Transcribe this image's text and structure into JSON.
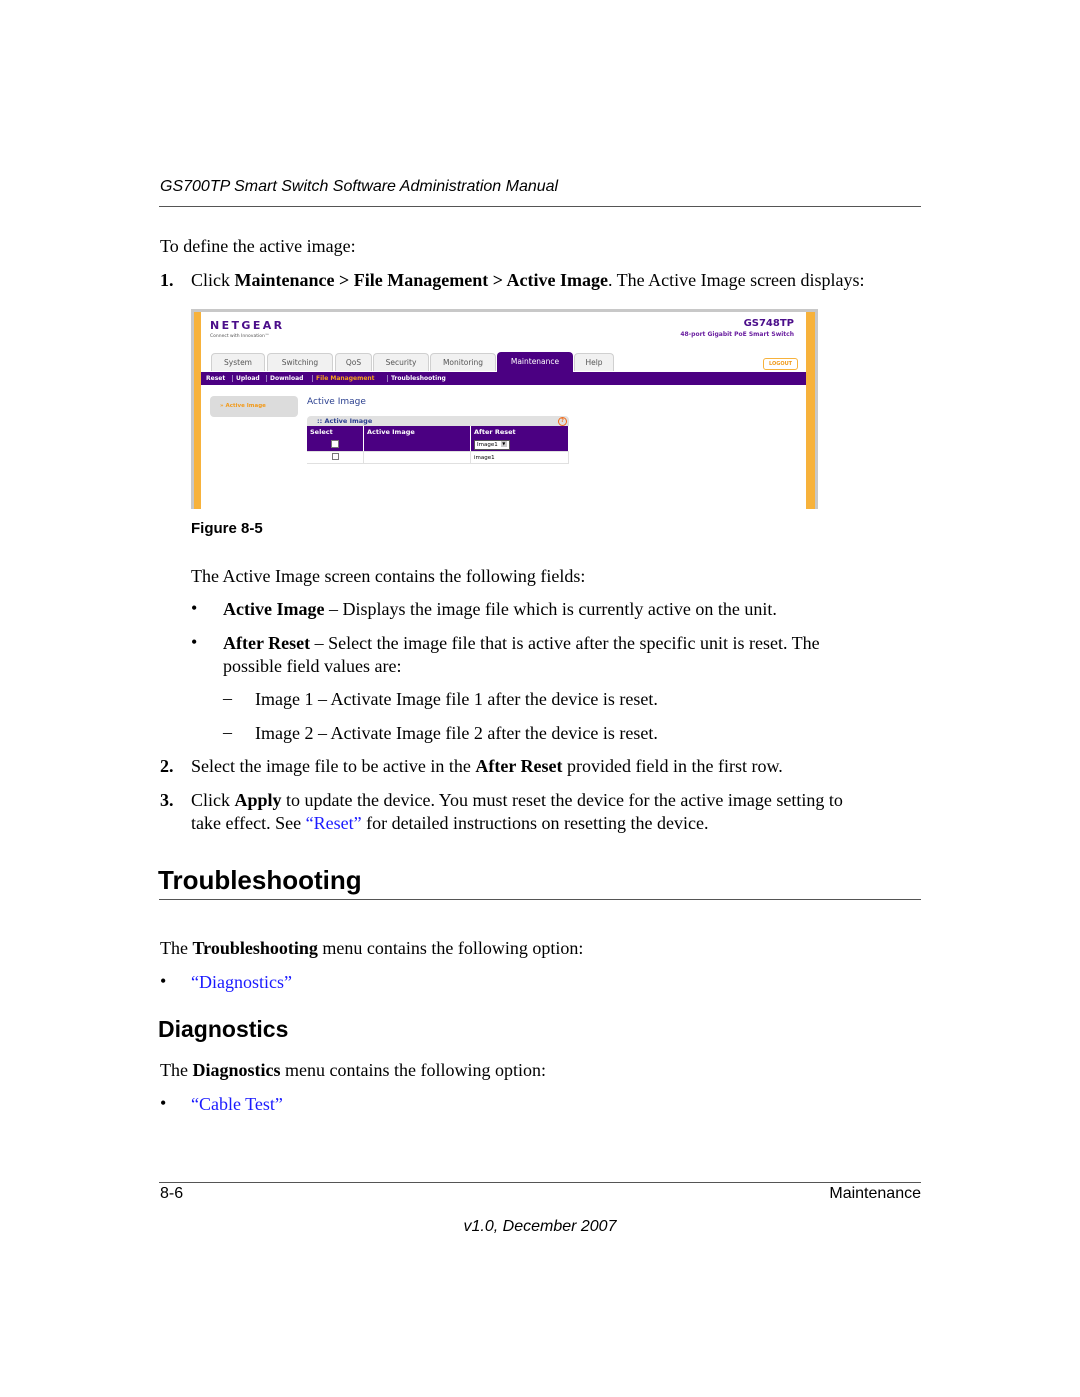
{
  "header": {
    "running_title": "GS700TP Smart Switch Software Administration Manual"
  },
  "intro": "To define the active image:",
  "step1": {
    "num": "1.",
    "prefix": "Click ",
    "b1": "Maintenance",
    "sep1": " > ",
    "b2": "File Management",
    "sep2": " > ",
    "b3": "Active Image",
    "suffix": ". The Active Image screen displays:"
  },
  "screenshot": {
    "logo": "NETGEAR",
    "tagline": "Connect with Innovation™",
    "model": "GS748TP",
    "model_desc": "48-port Gigabit PoE Smart Switch",
    "tabs": [
      "System",
      "Switching",
      "QoS",
      "Security",
      "Monitoring",
      "Maintenance",
      "Help"
    ],
    "active_tab": "Maintenance",
    "logout": "LOGOUT",
    "subnav": [
      "Reset",
      "Upload",
      "Download",
      "File Management",
      "Troubleshooting"
    ],
    "active_subnav": "File Management",
    "side_item": "» Active Image",
    "page_title": "Active Image",
    "panel_title": ":: Active Image",
    "info_icon": "?",
    "columns": [
      "Select",
      "Active Image",
      "After Reset"
    ],
    "rows": [
      {
        "select": false,
        "active_image": "",
        "after_reset": "Image1",
        "editable": true
      },
      {
        "select": false,
        "active_image": "",
        "after_reset": "image1",
        "editable": false
      }
    ],
    "colors": {
      "purple": "#4b0082",
      "orange": "#f7b23b",
      "title_blue": "#2a3f8f"
    }
  },
  "figure_caption": "Figure 8-5",
  "fields_intro": "The Active Image screen contains the following fields:",
  "fields": [
    {
      "term": "Active Image",
      "desc": " – Displays the image file which is currently active on the unit."
    },
    {
      "term": "After Reset",
      "desc": " – Select the image file that is active after the specific unit is reset. The",
      "desc2": "possible field values are:"
    }
  ],
  "values": [
    "Image 1 – Activate Image file 1 after the device is reset.",
    "Image 2 – Activate Image file 2 after the device is reset."
  ],
  "step2": {
    "num": "2.",
    "prefix": "Select the image file to be active in the ",
    "bold": "After Reset",
    "suffix": " provided field in the first row."
  },
  "step3": {
    "num": "3.",
    "prefix": "Click ",
    "bold": "Apply",
    "suffix": " to update the device. You must reset the device for the active image setting to",
    "line2_prefix": "take effect. See ",
    "link": "“Reset”",
    "line2_suffix": " for detailed instructions on resetting the device."
  },
  "troubleshooting": {
    "heading": "Troubleshooting",
    "intro_prefix": "The ",
    "intro_bold": "Troubleshooting",
    "intro_suffix": " menu contains the following option:",
    "link": "“Diagnostics”"
  },
  "diagnostics": {
    "heading": "Diagnostics",
    "intro_prefix": "The ",
    "intro_bold": "Diagnostics",
    "intro_suffix": " menu contains the following option:",
    "link": "“Cable Test”"
  },
  "footer": {
    "page": "8-6",
    "section": "Maintenance",
    "version": "v1.0, December 2007"
  },
  "bullet": "•",
  "dash": "–",
  "link_color": "#1a1aff"
}
